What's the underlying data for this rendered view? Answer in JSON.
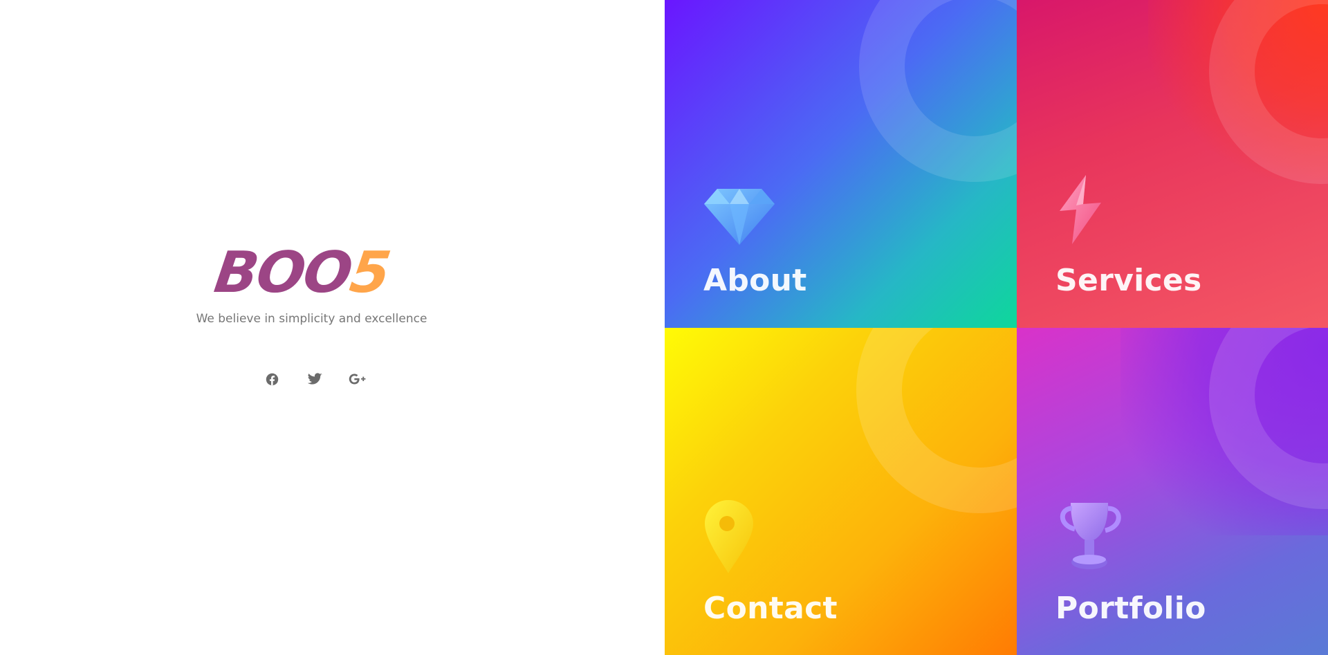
{
  "brand": {
    "logo_main": "BOO",
    "logo_accent": "5",
    "tagline": "We believe in simplicity and excellence"
  },
  "social": [
    {
      "name": "facebook",
      "icon": "facebook-icon"
    },
    {
      "name": "twitter",
      "icon": "twitter-icon"
    },
    {
      "name": "google-plus",
      "icon": "google-plus-icon"
    }
  ],
  "tiles": [
    {
      "title": "About",
      "icon": "diamond-icon"
    },
    {
      "title": "Services",
      "icon": "lightning-bolt-icon"
    },
    {
      "title": "Contact",
      "icon": "map-pin-icon"
    },
    {
      "title": "Portfolio",
      "icon": "trophy-icon"
    }
  ],
  "colors": {
    "logo_main": "#9c4585",
    "logo_accent": "#ffa54a",
    "tagline": "#767676",
    "social_icons": "#6b6b6b",
    "about_gradient": [
      "#6a16ff",
      "#0ed79b"
    ],
    "services_gradient": [
      "#d8176a",
      "#ff3a20",
      "#f45764"
    ],
    "contact_gradient": [
      "#fffb06",
      "#ff7b03"
    ],
    "portfolio_gradient": [
      "#d932c9",
      "#8a2ae8",
      "#5a7ad6"
    ]
  }
}
